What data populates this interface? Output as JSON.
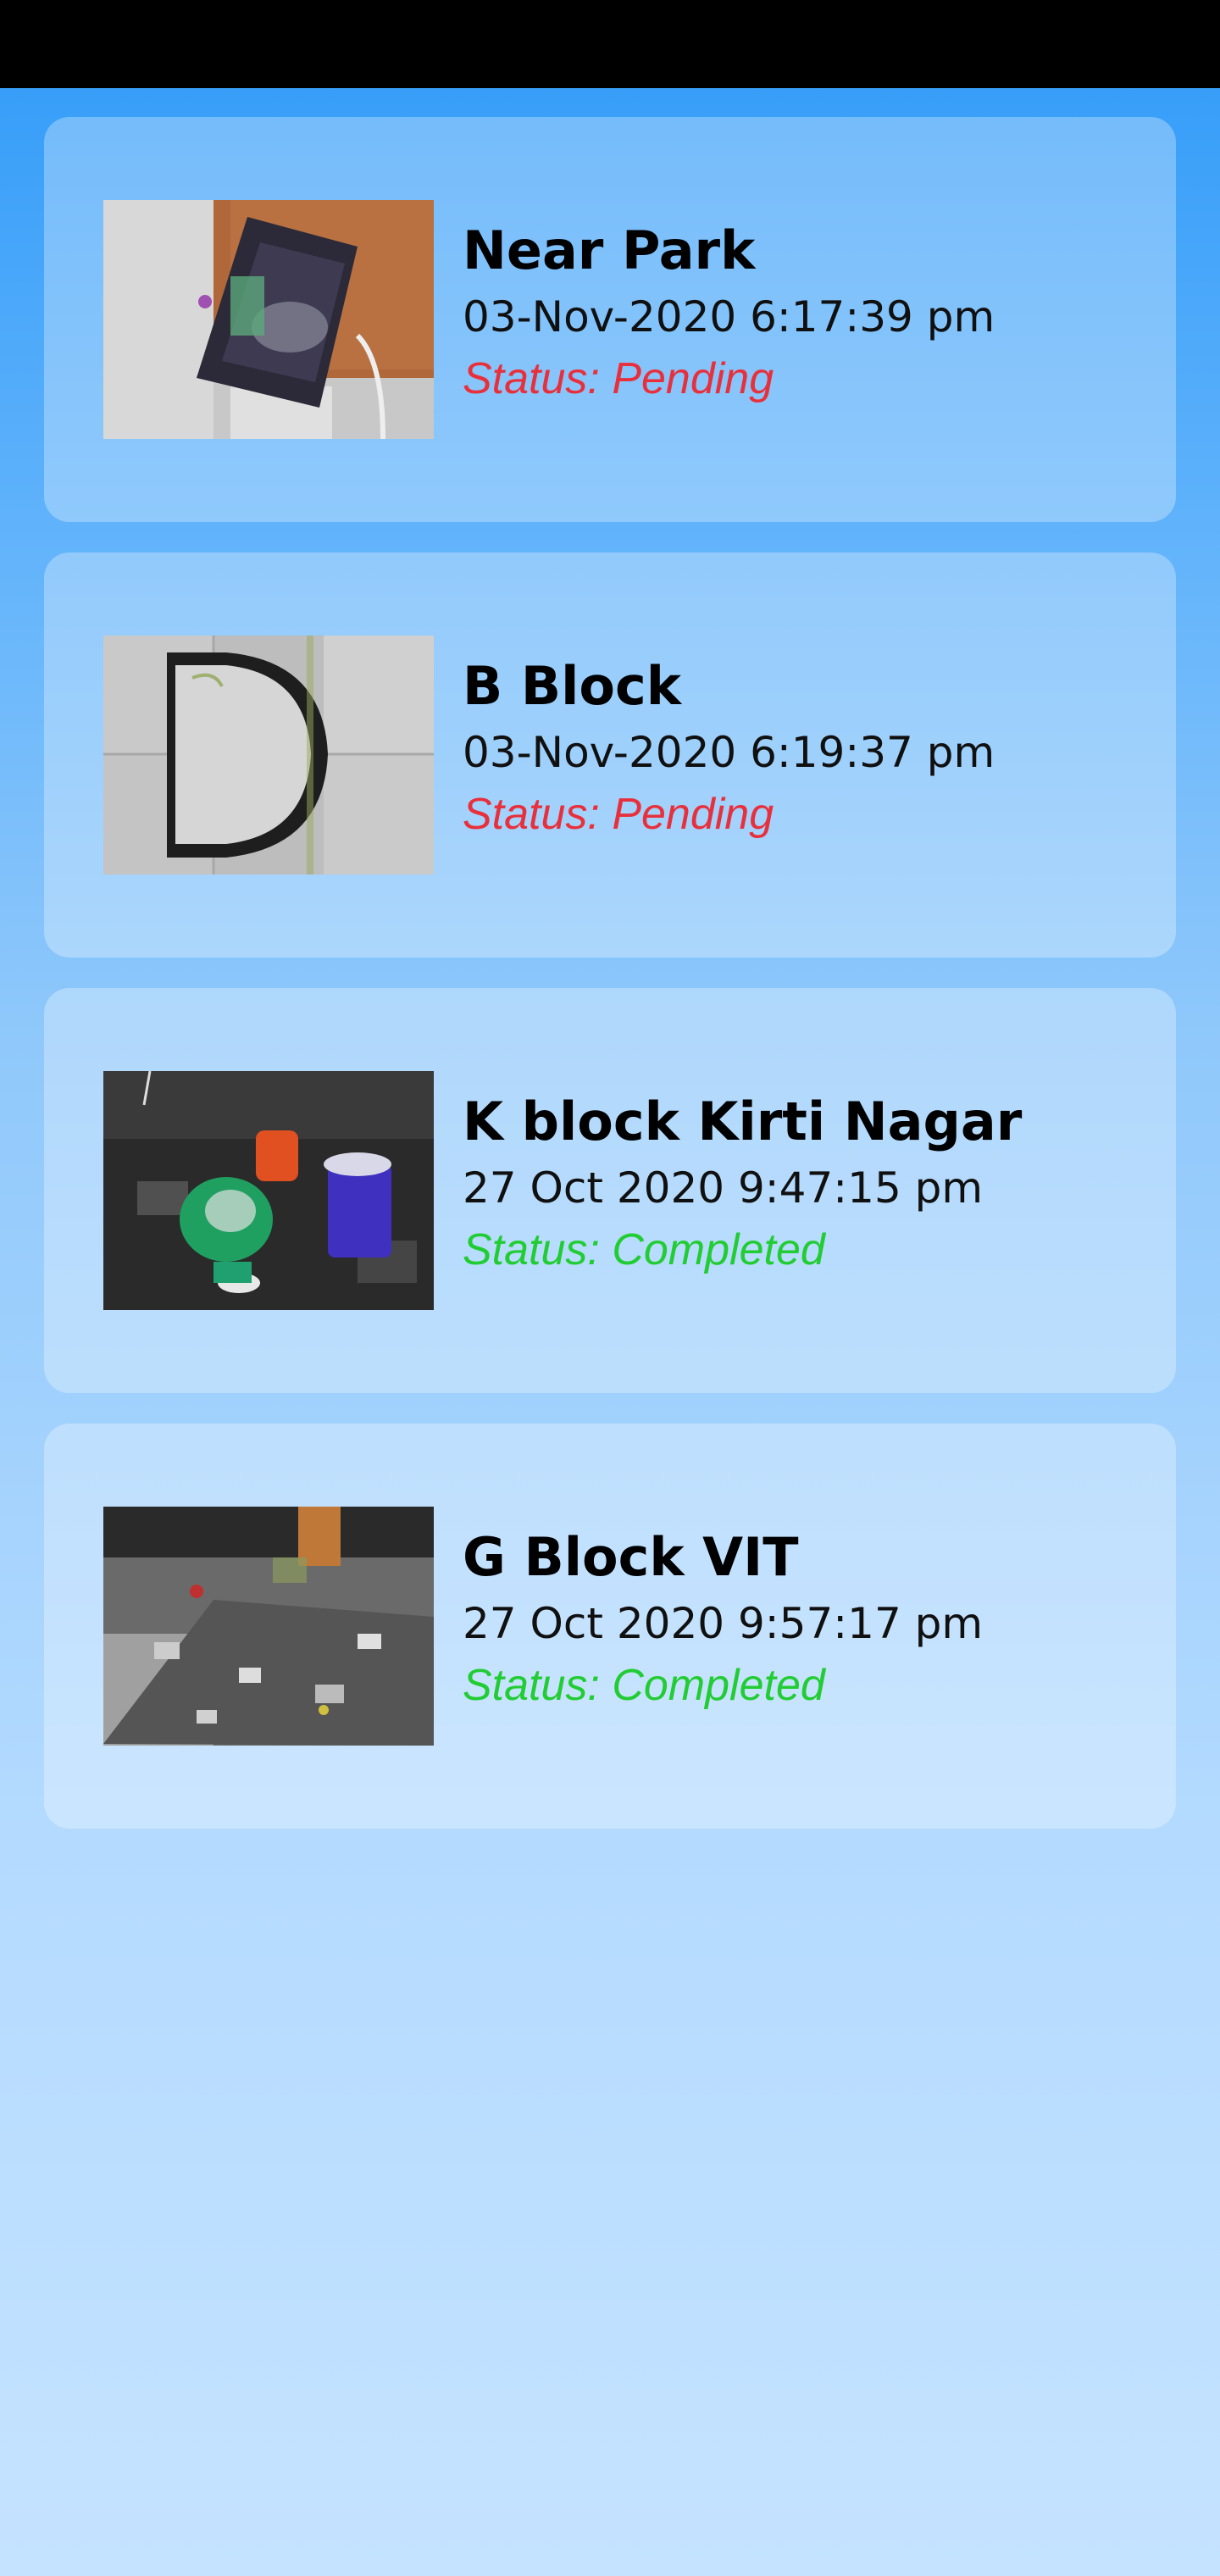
{
  "reports": [
    {
      "title": "Near Park",
      "datetime": "03-Nov-2020 6:17:39 pm",
      "status": "Status: Pending",
      "status_type": "pending",
      "thumbnail": "photo-snack-wrapper"
    },
    {
      "title": "B Block",
      "datetime": "03-Nov-2020 6:19:37 pm",
      "status": "Status: Pending",
      "status_type": "pending",
      "thumbnail": "photo-bucket-on-tiles"
    },
    {
      "title": "K block Kirti Nagar",
      "datetime": "27 Oct 2020 9:47:15 pm",
      "status": "Status: Completed",
      "status_type": "completed",
      "thumbnail": "photo-trash-bins-at-night"
    },
    {
      "title": "G Block VIT",
      "datetime": "27 Oct 2020 9:57:17 pm",
      "status": "Status: Completed",
      "status_type": "completed",
      "thumbnail": "photo-littered-ground"
    }
  ],
  "colors": {
    "pending": "#e8303c",
    "completed": "#22cc33"
  }
}
